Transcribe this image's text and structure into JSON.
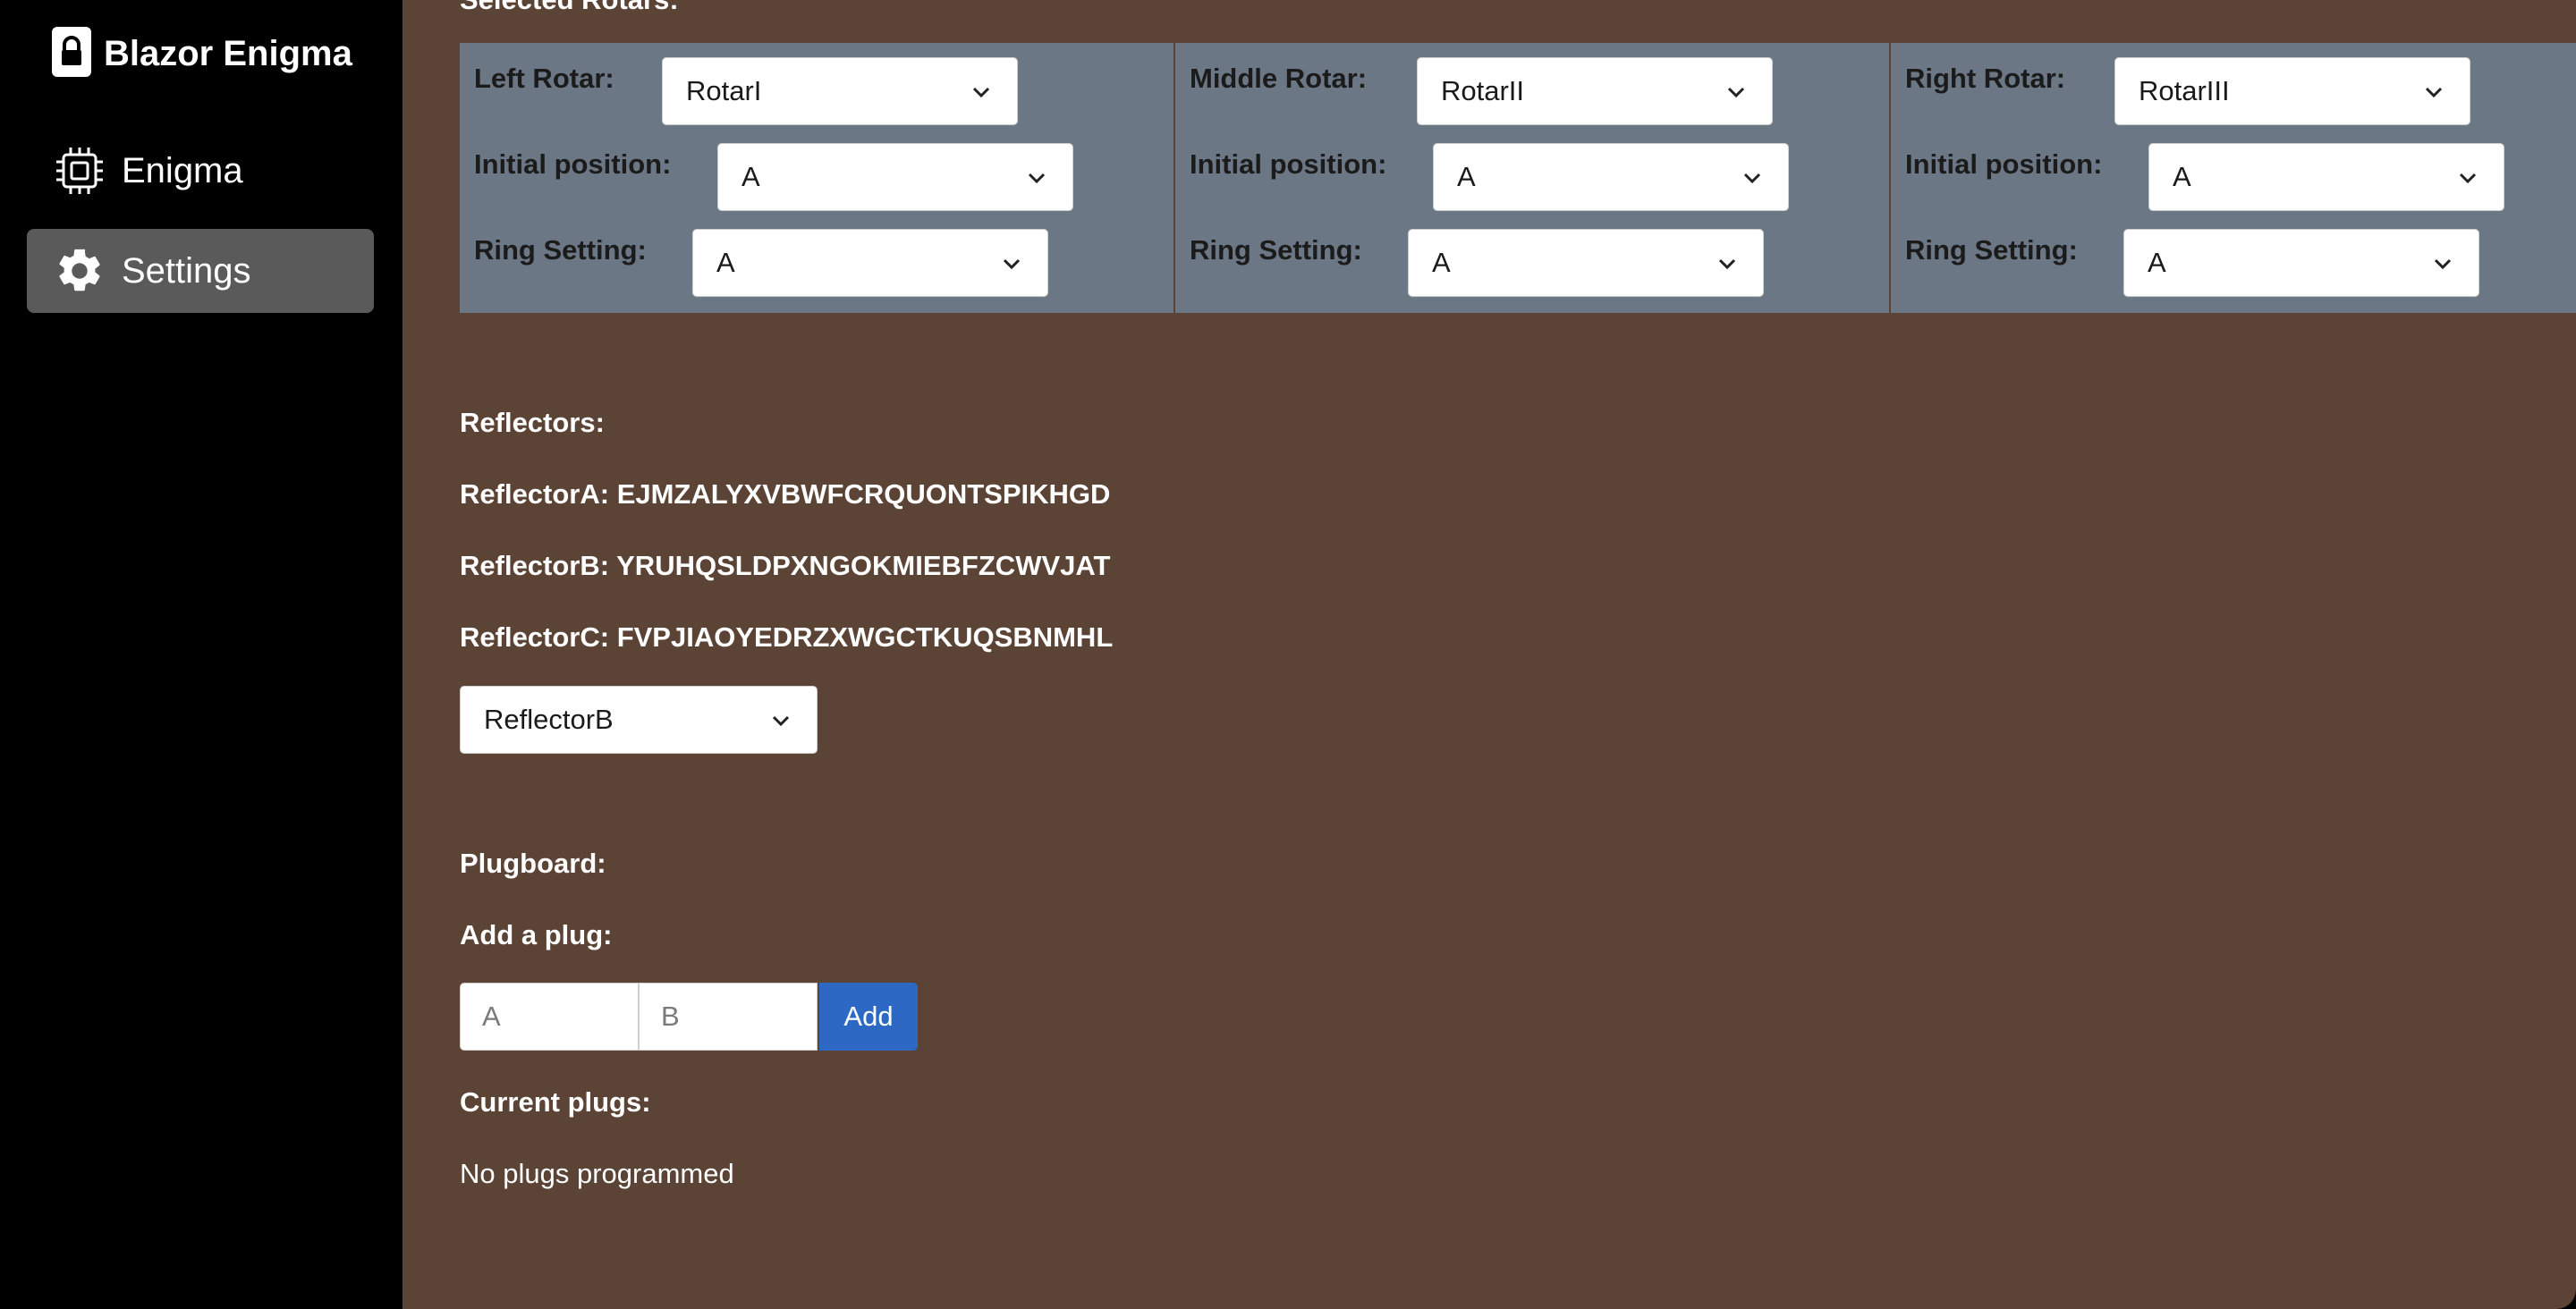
{
  "app": {
    "brand": "Blazor Enigma"
  },
  "nav": [
    {
      "label": "Enigma",
      "icon": "cpu-icon",
      "active": false
    },
    {
      "label": "Settings",
      "icon": "gear-icon",
      "active": true
    }
  ],
  "section_title_cut": "Selected Rotars:",
  "rotors": [
    {
      "label": "Left Rotar:",
      "value": "RotarI",
      "initial_label": "Initial position:",
      "initial_value": "A",
      "ring_label": "Ring Setting:",
      "ring_value": "A"
    },
    {
      "label": "Middle Rotar:",
      "value": "RotarII",
      "initial_label": "Initial position:",
      "initial_value": "A",
      "ring_label": "Ring Setting:",
      "ring_value": "A"
    },
    {
      "label": "Right Rotar:",
      "value": "RotarIII",
      "initial_label": "Initial position:",
      "initial_value": "A",
      "ring_label": "Ring Setting:",
      "ring_value": "A"
    }
  ],
  "reflectors": {
    "heading": "Reflectors:",
    "items": [
      "ReflectorA: EJMZALYXVBWFCRQUONTSPIKHGD",
      "ReflectorB: YRUHQSLDPXNGOKMIEBFZCWVJAT",
      "ReflectorC: FVPJIAOYEDRZXWGCTKUQSBNMHL"
    ],
    "selected": "ReflectorB"
  },
  "plugboard": {
    "heading": "Plugboard:",
    "add_heading": "Add a plug:",
    "input_a_placeholder": "A",
    "input_b_placeholder": "B",
    "add_label": "Add",
    "current_heading": "Current plugs:",
    "empty_text": "No plugs programmed"
  },
  "colors": {
    "sidebar_bg": "#000000",
    "main_bg": "#5b4335",
    "panel_bg": "#6c7785",
    "active_nav_bg": "#5a5a5a",
    "primary_button": "#2c68c4"
  }
}
